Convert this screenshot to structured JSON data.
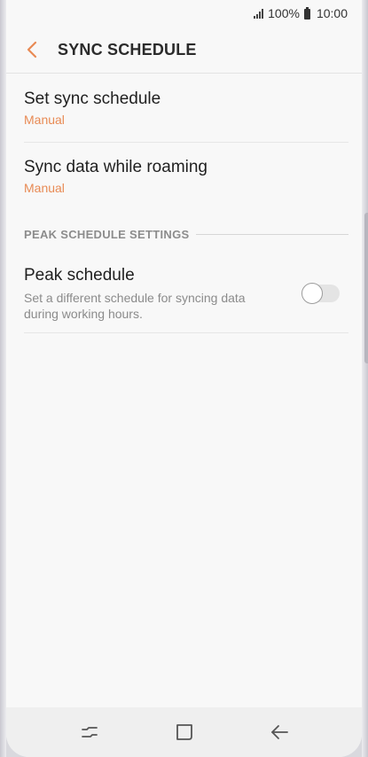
{
  "status_bar": {
    "battery_percent": "100%",
    "time": "10:00"
  },
  "app_bar": {
    "title": "SYNC SCHEDULE",
    "back_icon": "chevron-left-icon",
    "accent_color": "#e88a54"
  },
  "items": [
    {
      "title": "Set sync schedule",
      "subtitle": "Manual"
    },
    {
      "title": "Sync data while roaming",
      "subtitle": "Manual"
    }
  ],
  "peak_section": {
    "header": "PEAK SCHEDULE SETTINGS",
    "title": "Peak schedule",
    "description": "Set a different schedule for syncing data during working hours.",
    "toggle_on": false
  },
  "nav_bar": {
    "icons": [
      "recent-apps-icon",
      "home-icon",
      "back-icon"
    ]
  }
}
